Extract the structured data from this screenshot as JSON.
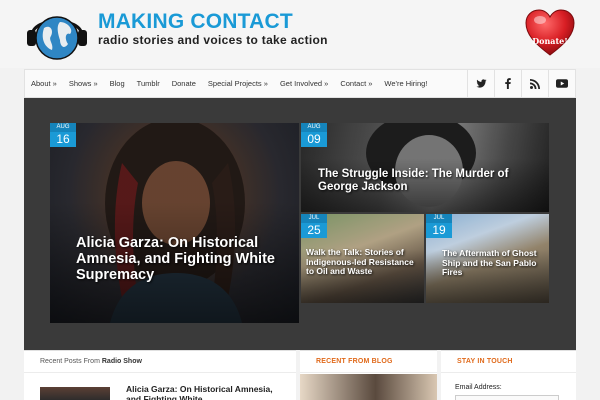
{
  "header": {
    "title": "MAKING CONTACT",
    "tagline": "radio stories and voices to take action",
    "donate_label": "Donate!"
  },
  "nav": {
    "items": [
      {
        "label": "About »"
      },
      {
        "label": "Shows »"
      },
      {
        "label": "Blog"
      },
      {
        "label": "Tumblr"
      },
      {
        "label": "Donate"
      },
      {
        "label": "Special Projects »"
      },
      {
        "label": "Get Involved »"
      },
      {
        "label": "Contact »"
      },
      {
        "label": "We're Hiring!"
      }
    ],
    "social": [
      "twitter-icon",
      "facebook-icon",
      "rss-icon",
      "youtube-icon"
    ]
  },
  "featured": [
    {
      "month": "AUG",
      "day": "16",
      "title": "Alicia Garza: On Historical Amnesia, and Fighting White Supremacy"
    },
    {
      "month": "AUG",
      "day": "09",
      "title": "The Struggle Inside: The Murder of George Jackson"
    },
    {
      "month": "JUL",
      "day": "25",
      "title": "Walk the Talk: Stories of Indigenous-led Resistance to Oil and Waste"
    },
    {
      "month": "JUL",
      "day": "19",
      "title": "The Aftermath of Ghost Ship and the San Pablo Fires"
    }
  ],
  "sections": {
    "recent_posts_prefix": "Recent Posts From",
    "recent_posts_category": "Radio Show",
    "recent_post_title": "Alicia Garza: On Historical Amnesia, and Fighting White",
    "blog_heading": "RECENT FROM BLOG",
    "stay_heading": "STAY IN TOUCH",
    "email_label": "Email Address:"
  },
  "colors": {
    "brand_blue": "#1a9ad6",
    "accent_orange": "#e06a1b",
    "donate_red": "#d81e24"
  }
}
